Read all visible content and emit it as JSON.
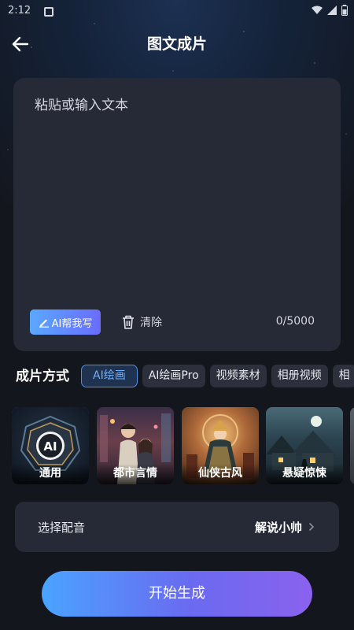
{
  "status_bar": {
    "time": "2:12"
  },
  "header": {
    "title": "图文成片"
  },
  "text_card": {
    "placeholder": "粘贴或输入文本",
    "ai_write_label": "AI帮我写",
    "clear_label": "清除",
    "counter": "0/5000"
  },
  "mode": {
    "label": "成片方式",
    "chips": [
      {
        "label": "AI绘画",
        "active": true
      },
      {
        "label": "AI绘画Pro",
        "active": false
      },
      {
        "label": "视频素材",
        "active": false
      },
      {
        "label": "相册视频",
        "active": false
      },
      {
        "label": "相",
        "active": false
      }
    ]
  },
  "styles": [
    {
      "label": "通用",
      "selected": true
    },
    {
      "label": "都市言情",
      "selected": false
    },
    {
      "label": "仙侠古风",
      "selected": false
    },
    {
      "label": "悬疑惊悚",
      "selected": false
    }
  ],
  "voice": {
    "label": "选择配音",
    "value": "解说小帅"
  },
  "start_button": {
    "label": "开始生成"
  },
  "colors": {
    "background": "#14161d",
    "card": "#262a36",
    "accent_blue": "#4aa3ff",
    "accent_purple": "#6a6af0",
    "chip_active_border": "#4b8fe8"
  }
}
